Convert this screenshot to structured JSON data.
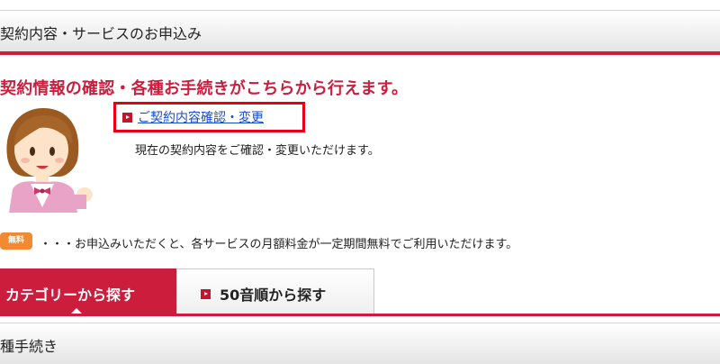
{
  "top_section": {
    "title": "契約内容・サービスのお申込み"
  },
  "headline": "契約情報の確認・各種お手続きがこちらから行えます。",
  "contract": {
    "link_label": "ご契約内容確認・変更",
    "description": "現在の契約内容をご確認・変更いただけます。"
  },
  "free_note": {
    "badge": "無料",
    "text": "・・・お申込みいただくと、各サービスの月額料金が一定期間無料でご利用いただけます。"
  },
  "tabs": [
    {
      "label": "カテゴリーから探す",
      "active": true
    },
    {
      "label": "50音順から探す",
      "active": false
    }
  ],
  "bottom_section": {
    "title": "種手続き"
  },
  "colors": {
    "accent": "#cc1e3c",
    "link": "#1a4ec2",
    "badge": "#f08b33",
    "highlight_border": "#e60012"
  },
  "icons": {
    "arrow": "arrow-right-icon",
    "mascot": "support-mascot-icon"
  }
}
